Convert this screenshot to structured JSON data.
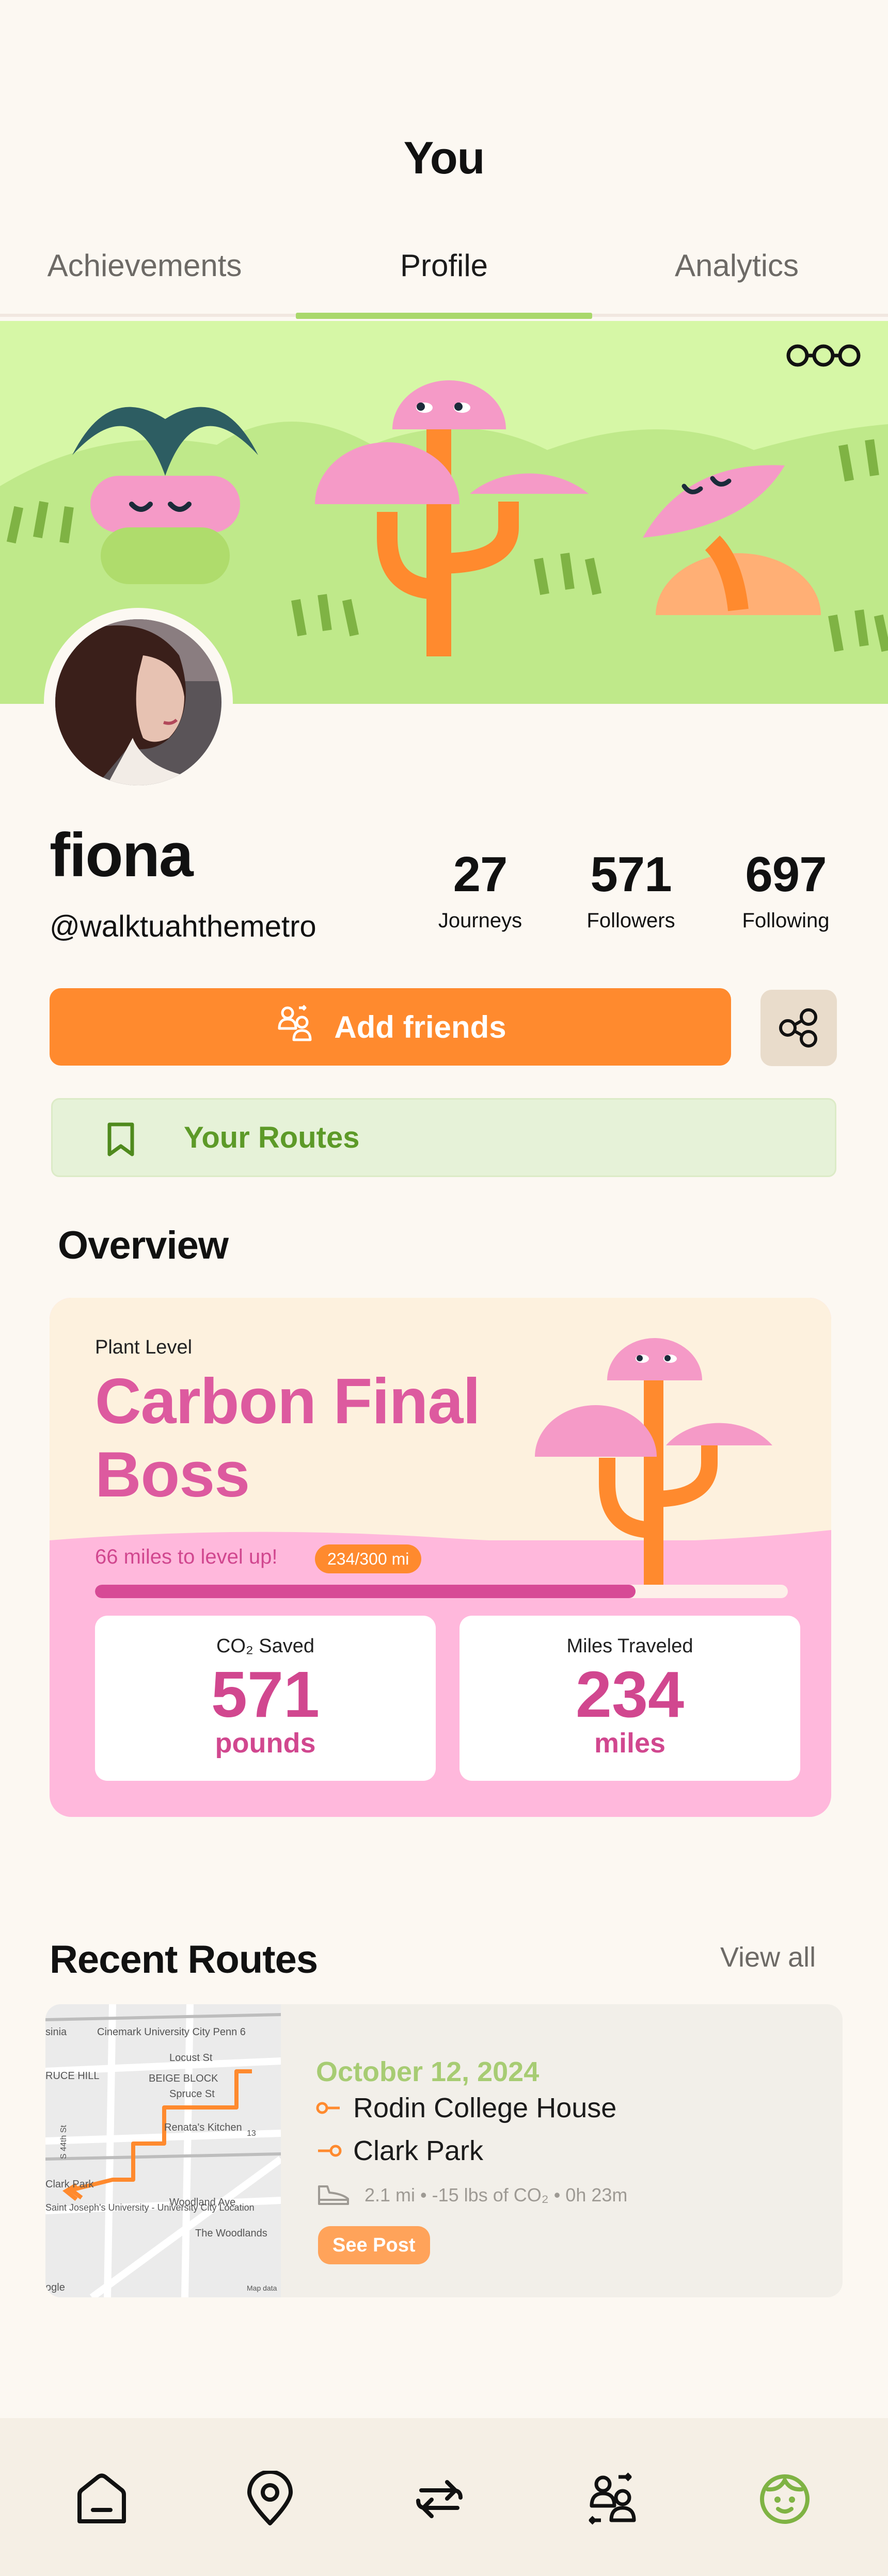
{
  "header": {
    "title": "You"
  },
  "tabs": [
    {
      "label": "Achievements"
    },
    {
      "label": "Profile",
      "active": true
    },
    {
      "label": "Analytics"
    }
  ],
  "banner": {
    "menu_icon": "more-dots-icon"
  },
  "profile": {
    "name": "fiona",
    "handle": "@walktuahthemetro",
    "stats": [
      {
        "value": "27",
        "label": "Journeys"
      },
      {
        "value": "571",
        "label": "Followers"
      },
      {
        "value": "697",
        "label": "Following"
      }
    ]
  },
  "actions": {
    "add_friends": "Add friends",
    "your_routes": "Your Routes"
  },
  "overview": {
    "heading": "Overview",
    "plant_level_label": "Plant Level",
    "level_name": "Carbon Final Boss",
    "level_up_text": "66 miles to level up!",
    "progress_badge": "234/300 mi",
    "progress_fraction": 0.78,
    "co2": {
      "label": "CO₂ Saved",
      "value": "571",
      "unit": "pounds"
    },
    "miles": {
      "label": "Miles Traveled",
      "value": "234",
      "unit": "miles"
    }
  },
  "recent_routes": {
    "heading": "Recent Routes",
    "view_all": "View all",
    "items": [
      {
        "date": "October 12, 2024",
        "from": "Rodin College House",
        "to": "Clark Park",
        "meta": "2.1 mi • -15 lbs of CO₂ • 0h 23m",
        "see_post": "See Post",
        "map_labels": {
          "cinemark": "Cinemark University City Penn 6",
          "locust": "Locust St",
          "spruce_hill": "RUCE HILL",
          "beige_block": "BEIGE BLOCK",
          "spruce_st": "Spruce St",
          "renatas": "Renata's Kitchen",
          "s44": "S 44th St",
          "clark_park": "Clark Park",
          "woodland": "Woodland Ave",
          "saint_josephs": "Saint Joseph's University - University City Location",
          "woodlands": "The Woodlands",
          "google": "ogle",
          "map_data": "Map data",
          "sina": "sinia",
          "route_13": "13"
        }
      }
    ]
  },
  "colors": {
    "accent_orange": "#ff8a2e",
    "accent_pink": "#dd5a9f",
    "accent_green": "#a9d86b",
    "background": "#fcf8f2"
  },
  "bottom_nav": [
    {
      "icon": "home-icon"
    },
    {
      "icon": "location-pin-icon"
    },
    {
      "icon": "routes-arrows-icon"
    },
    {
      "icon": "friends-icon"
    },
    {
      "icon": "profile-face-icon",
      "active": true
    }
  ]
}
